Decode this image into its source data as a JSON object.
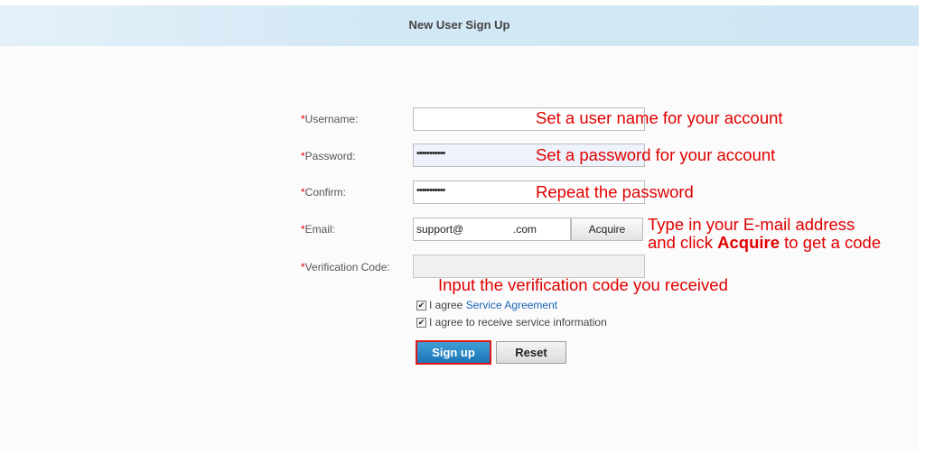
{
  "header": {
    "title": "New User Sign Up"
  },
  "form": {
    "username": {
      "label": "Username:",
      "value": ""
    },
    "password": {
      "label": "Password:",
      "value": "•••••••••••"
    },
    "confirm": {
      "label": "Confirm:",
      "value": "•••••••••••"
    },
    "email": {
      "label": "Email:",
      "value_prefix": "support@",
      "value_suffix": ".com",
      "acquire_label": "Acquire"
    },
    "verification": {
      "label": "Verification Code:",
      "value": ""
    },
    "required_mark": "*",
    "agree_prefix": "I agree",
    "agree_link": "Service Agreement",
    "agree_service_info": "I agree to receive service information",
    "agree_checked": true,
    "service_info_checked": true,
    "signup_label": "Sign up",
    "reset_label": "Reset"
  },
  "annotations": {
    "username": "Set a user name for your account",
    "password": "Set a password for your account",
    "repeat": "Repeat the password",
    "email_line1": "Type in your E-mail address",
    "email_line2_prefix": "and click ",
    "email_line2_bold": "Acquire",
    "email_line2_suffix": " to get a code",
    "verification": "Input the verification code you received"
  },
  "colors": {
    "annotation": "#e00000",
    "header_bg": "#d5e9f6",
    "signup_bg": "#2a86c7",
    "link": "#1b63b8"
  }
}
